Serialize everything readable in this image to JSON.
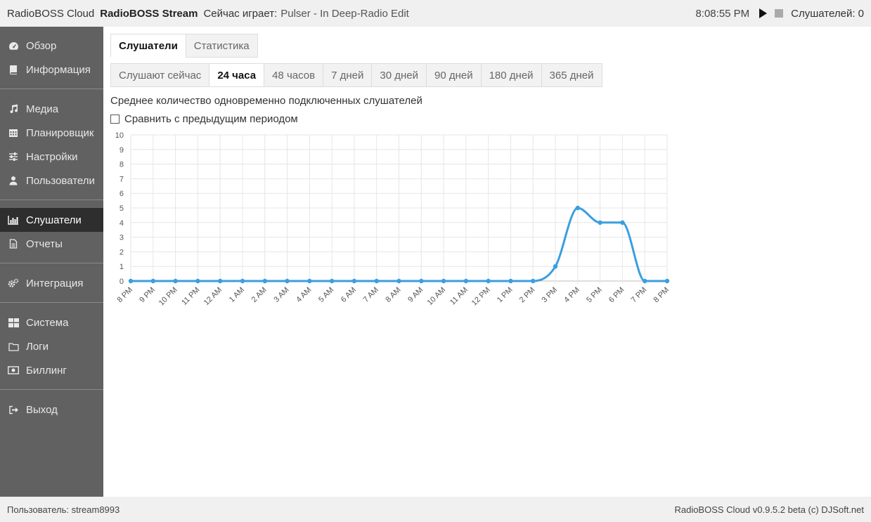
{
  "topbar": {
    "app_name": "RadioBOSS Cloud",
    "station": "RadioBOSS Stream",
    "now_playing_label": "Сейчас играет:",
    "now_playing_track": "Pulser - In Deep-Radio Edit",
    "clock": "8:08:55 PM",
    "listeners_label": "Слушателей: 0"
  },
  "sidebar": {
    "groups": [
      [
        {
          "label": "Обзор",
          "icon": "dashboard-icon"
        },
        {
          "label": "Информация",
          "icon": "book-icon"
        }
      ],
      [
        {
          "label": "Медиа",
          "icon": "music-icon"
        },
        {
          "label": "Планировщик",
          "icon": "calendar-icon"
        },
        {
          "label": "Настройки",
          "icon": "sliders-icon"
        },
        {
          "label": "Пользователи",
          "icon": "user-icon"
        }
      ],
      [
        {
          "label": "Слушатели",
          "icon": "bar-chart-icon",
          "active": true
        },
        {
          "label": "Отчеты",
          "icon": "document-icon"
        }
      ],
      [
        {
          "label": "Интеграция",
          "icon": "gears-icon"
        }
      ],
      [
        {
          "label": "Система",
          "icon": "grid-icon"
        },
        {
          "label": "Логи",
          "icon": "folder-icon"
        },
        {
          "label": "Биллинг",
          "icon": "money-icon"
        }
      ],
      [
        {
          "label": "Выход",
          "icon": "logout-icon"
        }
      ]
    ]
  },
  "tabs": [
    {
      "label": "Слушатели",
      "active": true
    },
    {
      "label": "Статистика",
      "active": false
    }
  ],
  "periods": [
    {
      "label": "Слушают сейчас",
      "active": false
    },
    {
      "label": "24 часа",
      "active": true
    },
    {
      "label": "48 часов",
      "active": false
    },
    {
      "label": "7 дней",
      "active": false
    },
    {
      "label": "30 дней",
      "active": false
    },
    {
      "label": "90 дней",
      "active": false
    },
    {
      "label": "180 дней",
      "active": false
    },
    {
      "label": "365 дней",
      "active": false
    }
  ],
  "chart_heading": "Среднее количество одновременно подключенных слушателей",
  "compare_label": "Сравнить с предыдущим периодом",
  "chart_data": {
    "type": "line",
    "categories": [
      "8 PM",
      "9 PM",
      "10 PM",
      "11 PM",
      "12 AM",
      "1 AM",
      "2 AM",
      "3 AM",
      "4 AM",
      "5 AM",
      "6 AM",
      "7 AM",
      "8 AM",
      "9 AM",
      "10 AM",
      "11 AM",
      "12 PM",
      "1 PM",
      "2 PM",
      "3 PM",
      "4 PM",
      "5 PM",
      "6 PM",
      "7 PM",
      "8 PM"
    ],
    "values": [
      0,
      0,
      0,
      0,
      0,
      0,
      0,
      0,
      0,
      0,
      0,
      0,
      0,
      0,
      0,
      0,
      0,
      0,
      0,
      1,
      5,
      4,
      4,
      0,
      0
    ],
    "ylim": [
      0,
      10
    ],
    "yticks": [
      0,
      1,
      2,
      3,
      4,
      5,
      6,
      7,
      8,
      9,
      10
    ],
    "grid": true,
    "color": "#3b9ee0"
  },
  "footer": {
    "user_label": "Пользователь: stream8993",
    "version": "RadioBOSS Cloud v0.9.5.2 beta (c) DJSoft.net"
  }
}
